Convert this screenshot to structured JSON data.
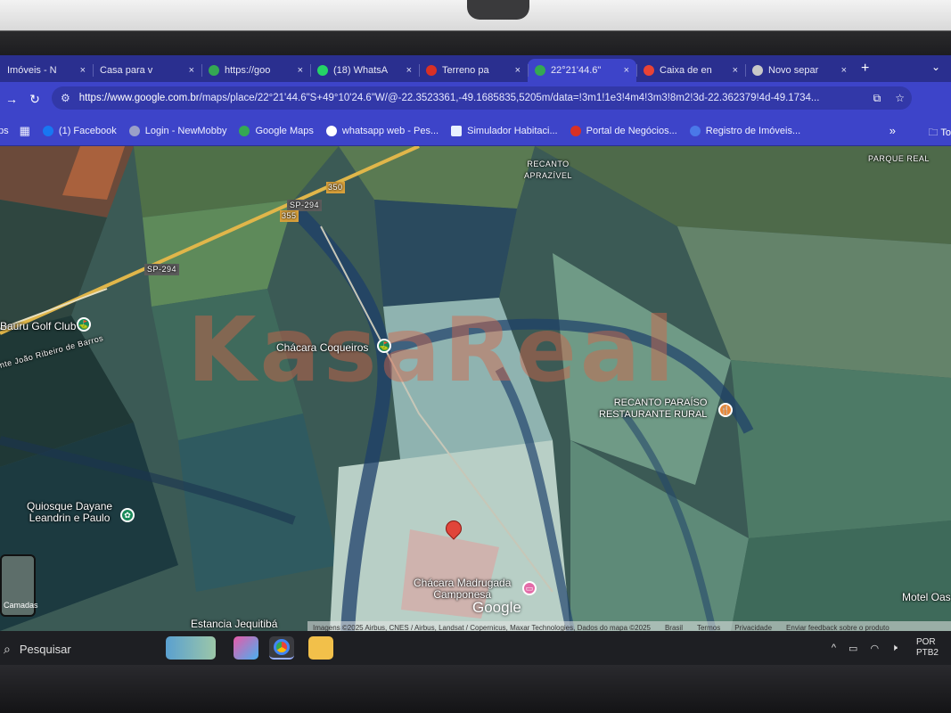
{
  "browser": {
    "tabs": [
      {
        "title": "Imóveis - N",
        "favicon_color": "#e9a13b",
        "active": false
      },
      {
        "title": "Casa para v",
        "favicon_color": "#2a2f8f",
        "active": false
      },
      {
        "title": "https://goo",
        "favicon_color": "#34a853",
        "active": false
      },
      {
        "title": "(18) WhatsA",
        "favicon_color": "#25d366",
        "active": false
      },
      {
        "title": "Terreno pa",
        "favicon_color": "#d93025",
        "active": false
      },
      {
        "title": "22°21'44.6\"",
        "favicon_color": "#34a853",
        "active": true
      },
      {
        "title": "Caixa de en",
        "favicon_color": "#ea4335",
        "active": false
      },
      {
        "title": "Novo separ",
        "favicon_color": "#c8c8c8",
        "active": false
      }
    ],
    "tab_close_glyph": "×",
    "new_tab_glyph": "+",
    "url": {
      "host": "https://www.google.com.br",
      "path": "/maps/place/22°21'44.6\"S+49°10'24.6\"W/@-22.3523361,-49.1685835,5205m/data=!3m1!1e3!4m4!3m3!8m2!3d-22.362379!4d-49.1734..."
    },
    "bookmarks": [
      {
        "label": "ps",
        "icon": "apps-icon",
        "color": "#3d44c9"
      },
      {
        "label": "(1) Facebook",
        "icon": "facebook-icon",
        "color": "#1877f2"
      },
      {
        "label": "Login - NewMobby",
        "icon": "globe-icon",
        "color": "#9aa0c8"
      },
      {
        "label": "Google Maps",
        "icon": "maps-icon",
        "color": "#34a853"
      },
      {
        "label": "whatsapp web - Pes...",
        "icon": "google-icon",
        "color": "#ffffff"
      },
      {
        "label": "Simulador Habitaci...",
        "icon": "caixa-icon",
        "color": "#e8f0ff"
      },
      {
        "label": "Portal de Negócios...",
        "icon": "portal-icon",
        "color": "#d93025"
      },
      {
        "label": "Registro de Imóveis...",
        "icon": "globe-icon",
        "color": "#4a78e8"
      }
    ],
    "bookmarks_more": "»",
    "bookmarks_folder": "To"
  },
  "map": {
    "watermark": "KasaReal",
    "labels": {
      "recanto_aprazivel": "RECANTO\nAPRAZÍVEL",
      "parque_real": "PARQUE REAL",
      "sp294_a": "SP-294",
      "sp294_b": "SP-294",
      "shield_350": "350",
      "shield_355": "355",
      "bauru_golf": "Bauru Golf Club",
      "joao_ribeiro": "nte João Ribeiro de Barros",
      "chacara_coqueiros": "Chácara Coqueiros",
      "recanto_paraiso": "RECANTO PARAÍSO\nRESTAURANTE RURAL",
      "quiosque": "Quiosque Dayane\nLeandrin e Paulo",
      "chacara_madrugada": "Chácara Madrugada\nCamponesa",
      "motel": "Motel Oas",
      "estancia": "Estancia Jequitibá"
    },
    "layers_label": "Camadas",
    "google_logo": "Google",
    "footer": {
      "imagery": "Imagens ©2025 Airbus, CNES / Airbus, Landsat / Copernicus, Maxar Technologies, Dados do mapa ©2025",
      "country": "Brasil",
      "terms": "Termos",
      "privacy": "Privacidade",
      "feedback": "Enviar feedback sobre o produto"
    }
  },
  "taskbar": {
    "search_placeholder": "Pesquisar",
    "language": "POR",
    "layout": "PTB2"
  }
}
